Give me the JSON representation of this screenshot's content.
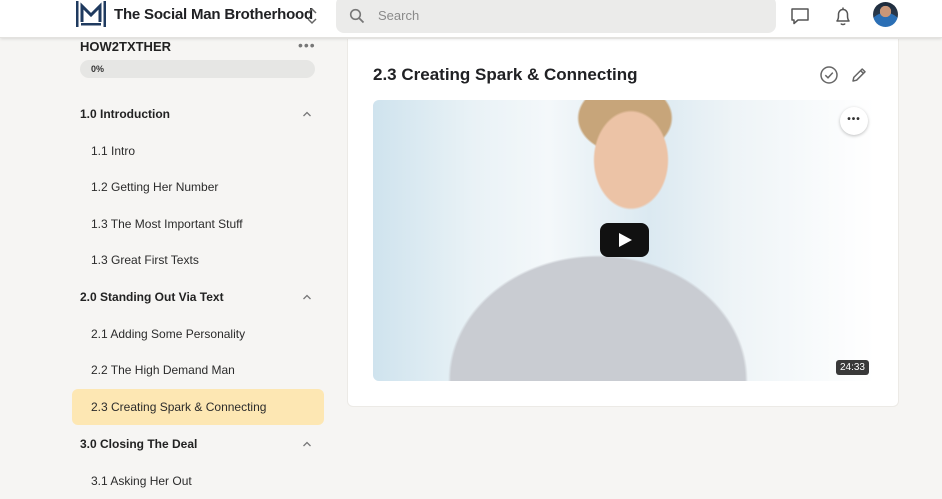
{
  "topbar": {
    "brand": "The Social Man Brotherhood",
    "search_placeholder": "Search"
  },
  "sidebar": {
    "course_title": "HOW2TXTHER",
    "menu_glyph": "•••",
    "progress_fraction": 0.0,
    "progress_label": "0%",
    "outline": [
      {
        "kind": "module",
        "label": "1.0 Introduction",
        "expanded": true
      },
      {
        "kind": "lesson",
        "label": "1.1 Intro",
        "active": false
      },
      {
        "kind": "lesson",
        "label": "1.2 Getting Her Number",
        "active": false
      },
      {
        "kind": "lesson",
        "label": "1.3 The Most Important Stuff",
        "active": false
      },
      {
        "kind": "lesson",
        "label": "1.3 Great First Texts",
        "active": false
      },
      {
        "kind": "module",
        "label": "2.0 Standing Out Via Text",
        "expanded": true
      },
      {
        "kind": "lesson",
        "label": "2.1 Adding Some Personality",
        "active": false
      },
      {
        "kind": "lesson",
        "label": "2.2 The High Demand Man",
        "active": false
      },
      {
        "kind": "lesson",
        "label": "2.3 Creating Spark & Connecting",
        "active": true
      },
      {
        "kind": "module",
        "label": "3.0 Closing The Deal",
        "expanded": true
      },
      {
        "kind": "lesson",
        "label": "3.1 Asking Her Out",
        "active": false
      }
    ]
  },
  "main": {
    "lesson_title": "2.3 Creating Spark & Connecting",
    "video": {
      "duration": "24:33",
      "menu_glyph": "•••"
    }
  },
  "colors": {
    "page_bg": "#f6f5f3",
    "active_lesson_bg": "#fde7b3",
    "progress_track": "#e6e6e4"
  },
  "icons": [
    "brand-logo",
    "chevron-up-down-icon",
    "search-icon",
    "chat-bubble-icon",
    "bell-icon",
    "user-avatar",
    "chevron-up-icon",
    "check-circle-icon",
    "pencil-icon",
    "play-icon",
    "more-icon"
  ]
}
